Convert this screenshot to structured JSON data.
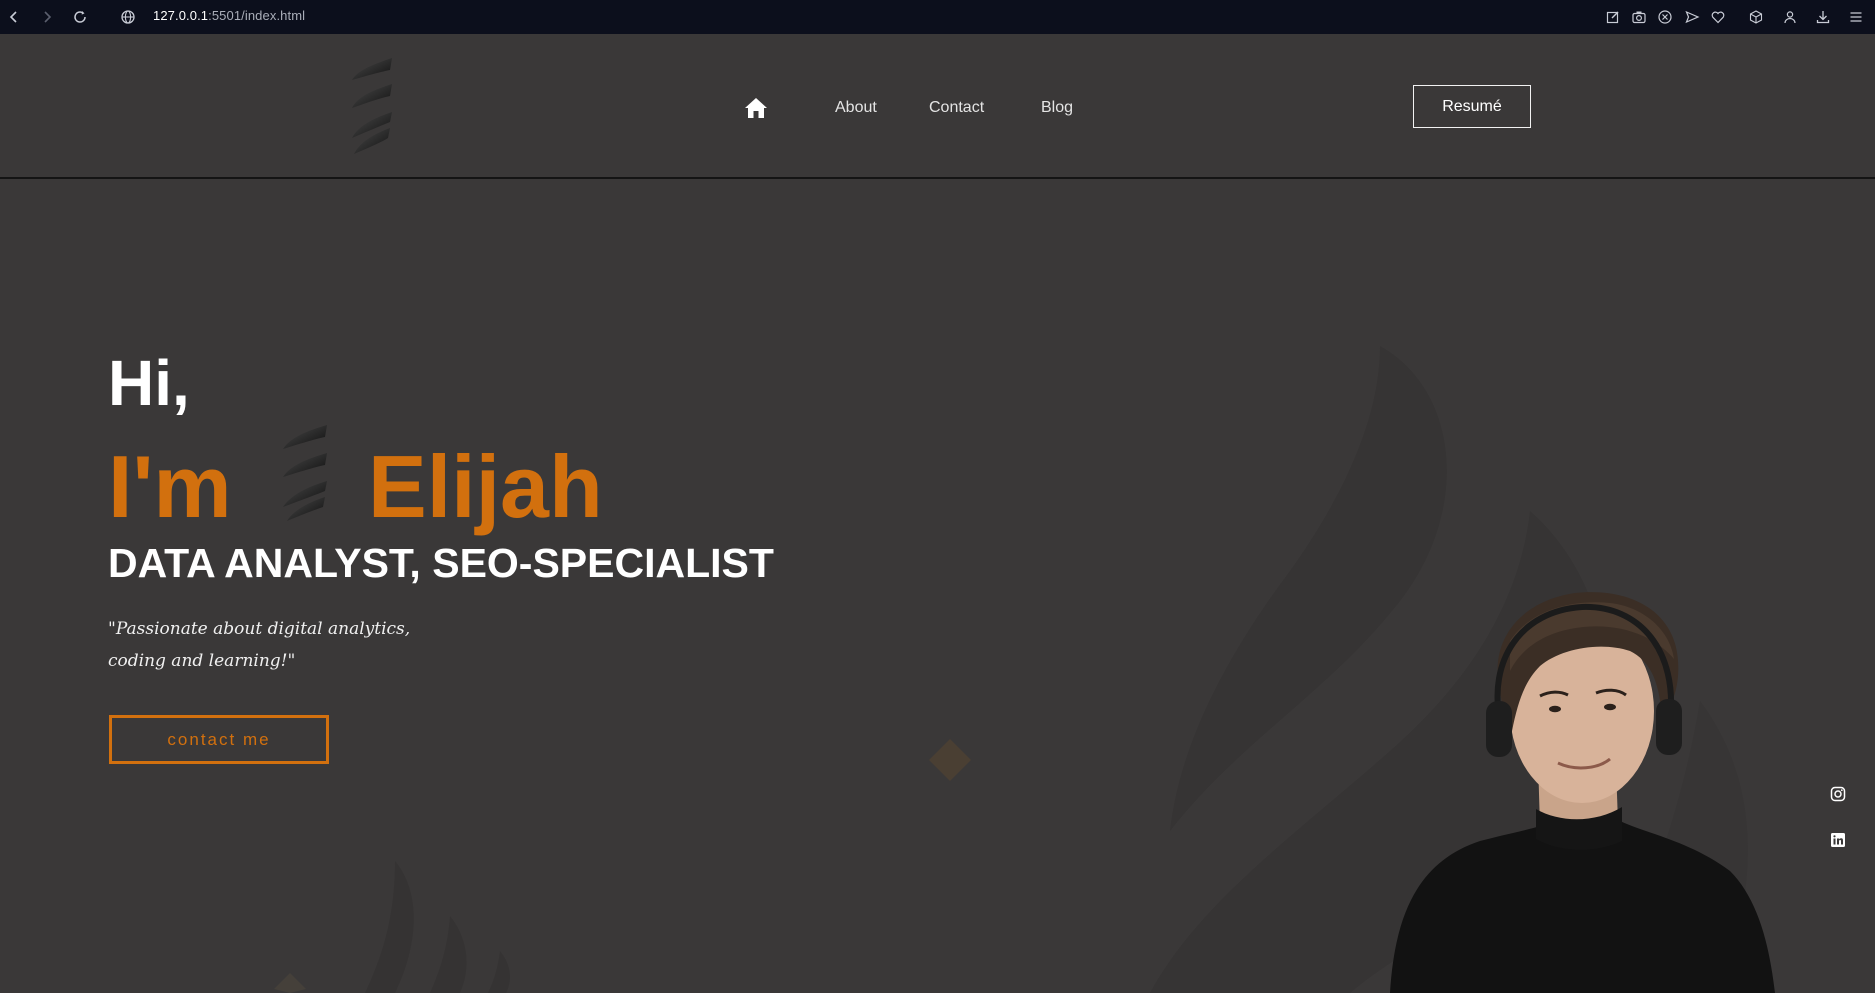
{
  "browser": {
    "url_host": "127.0.0.1",
    "url_rest": ":5501/index.html"
  },
  "header": {
    "nav": {
      "about": "About",
      "contact": "Contact",
      "blog": "Blog"
    },
    "resume_label": "Resumé"
  },
  "hero": {
    "greeting": "Hi,",
    "intro": "I'm",
    "name": "Elijah",
    "role": "DATA ANALYST, SEO-SPECIALIST",
    "quote": "\"Passionate about digital analytics, coding and learning!\"",
    "cta_label": "contact me"
  },
  "colors": {
    "accent": "#d2700e",
    "background": "#3a3838",
    "browser_bar": "#0c0f1c"
  },
  "icons": {
    "browser": [
      "back-icon",
      "forward-icon",
      "reload-icon",
      "globe-icon",
      "edit-icon",
      "camera-icon",
      "shield-icon",
      "send-icon",
      "heart-icon",
      "cube-icon",
      "user-icon",
      "download-icon",
      "menu-icon"
    ],
    "social": [
      "instagram-icon",
      "linkedin-icon"
    ]
  }
}
